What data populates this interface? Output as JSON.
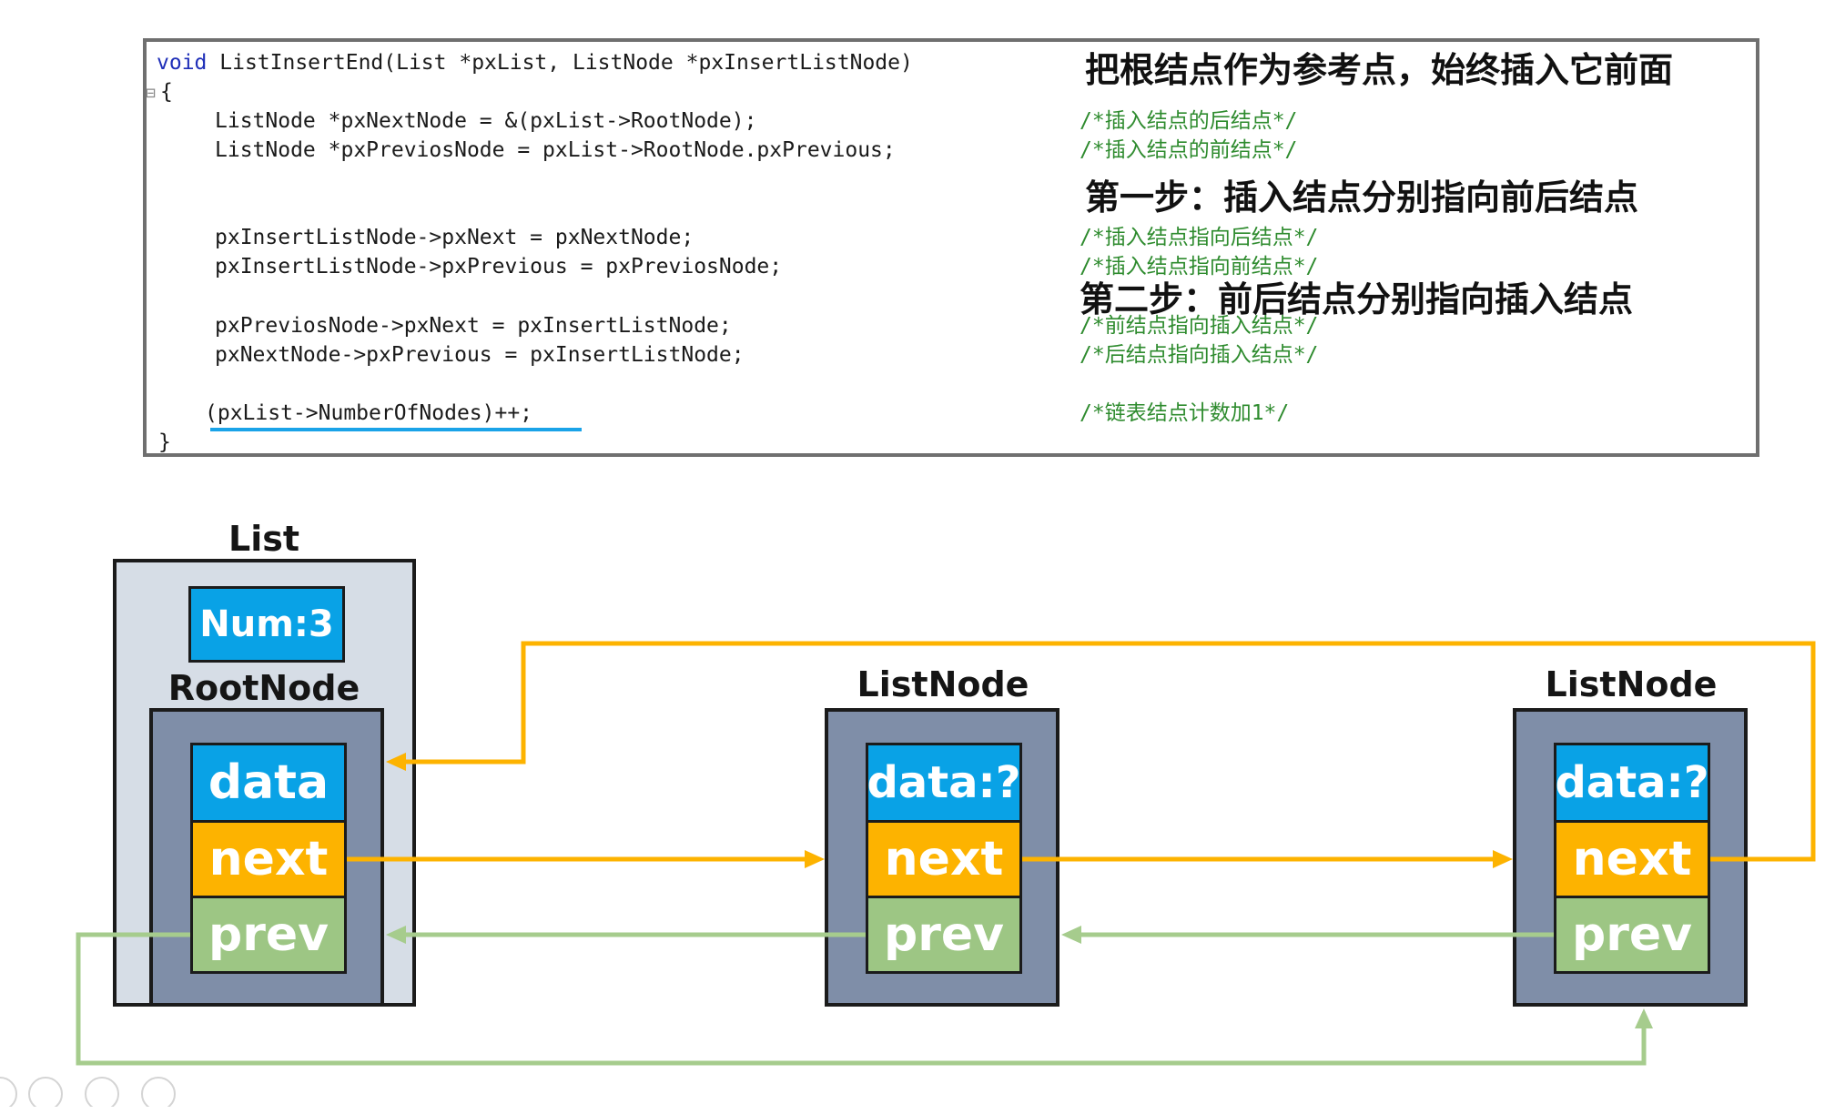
{
  "code": {
    "lines": [
      "ListInsertEnd(List *pxList, ListNode *pxInsertListNode)",
      "ListNode *pxNextNode = &(pxList->RootNode);",
      "ListNode *pxPreviosNode = pxList->RootNode.pxPrevious;",
      "pxInsertListNode->pxNext = pxNextNode;",
      "pxInsertListNode->pxPrevious = pxPreviosNode;",
      "pxPreviosNode->pxNext = pxInsertListNode;",
      "pxNextNode->pxPrevious = pxInsertListNode;",
      "(pxList->NumberOfNodes)++;"
    ],
    "keyword": "void",
    "open_brace": "{",
    "close_brace": "}",
    "fold_marker": "⊟",
    "comments": [
      "/*插入结点的后结点*/",
      "/*插入结点的前结点*/",
      "/*插入结点指向后结点*/",
      "/*插入结点指向前结点*/",
      "/*前结点指向插入结点*/",
      "/*后结点指向插入结点*/",
      "/*链表结点计数加1*/"
    ],
    "notes": [
      "把根结点作为参考点，始终插入它前面",
      "第一步：插入结点分别指向前后结点",
      "第二步：前后结点分别指向插入结点"
    ]
  },
  "diagram": {
    "list_label": "List",
    "num_label": "Num:3",
    "root_label": "RootNode",
    "root_fields": [
      "data",
      "next",
      "prev"
    ],
    "node1_label": "ListNode",
    "node1_fields": [
      "data:?",
      "next",
      "prev"
    ],
    "node2_label": "ListNode",
    "node2_fields": [
      "data:?",
      "next",
      "prev"
    ]
  },
  "colors": {
    "data": "#09a2e6",
    "next": "#fdb300",
    "prev": "#9dc684",
    "node_frame": "#7f8ea8",
    "list_frame": "#d6dde6"
  }
}
